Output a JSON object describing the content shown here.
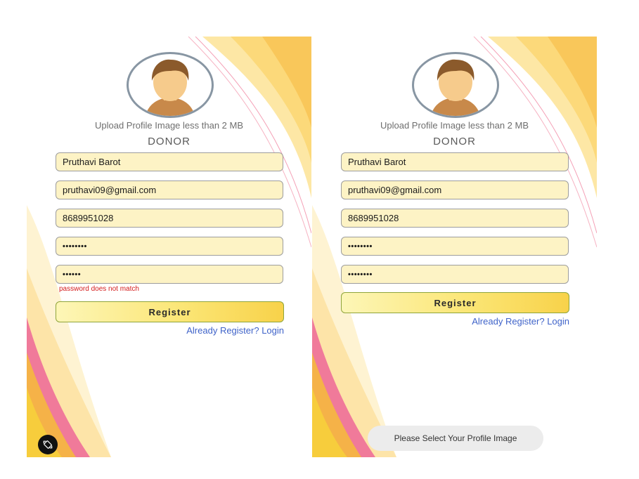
{
  "colors": {
    "field_bg": "#fdf3c5",
    "button_gradient_start": "#fdf6b7",
    "button_gradient_end": "#f8d24a",
    "link": "#3f63c9",
    "error": "#d41b1b"
  },
  "screens": [
    {
      "upload_label": "Upload Profile Image less than 2 MB",
      "role": "DONOR",
      "fields": {
        "name": "Pruthavi Barot",
        "email": "pruthavi09@gmail.com",
        "phone": "8689951028",
        "password": "••••••••",
        "confirm_password": "••••••"
      },
      "error": "password does not match",
      "register_label": "Register",
      "login_link": "Already Register? Login",
      "rotate_icon": "screen-rotate-icon"
    },
    {
      "upload_label": "Upload Profile Image less than 2 MB",
      "role": "DONOR",
      "fields": {
        "name": "Pruthavi Barot",
        "email": "pruthavi09@gmail.com",
        "phone": "8689951028",
        "password": "••••••••",
        "confirm_password": "••••••••"
      },
      "register_label": "Register",
      "login_link": "Already Register? Login",
      "toast": "Please Select Your Profile Image"
    }
  ]
}
